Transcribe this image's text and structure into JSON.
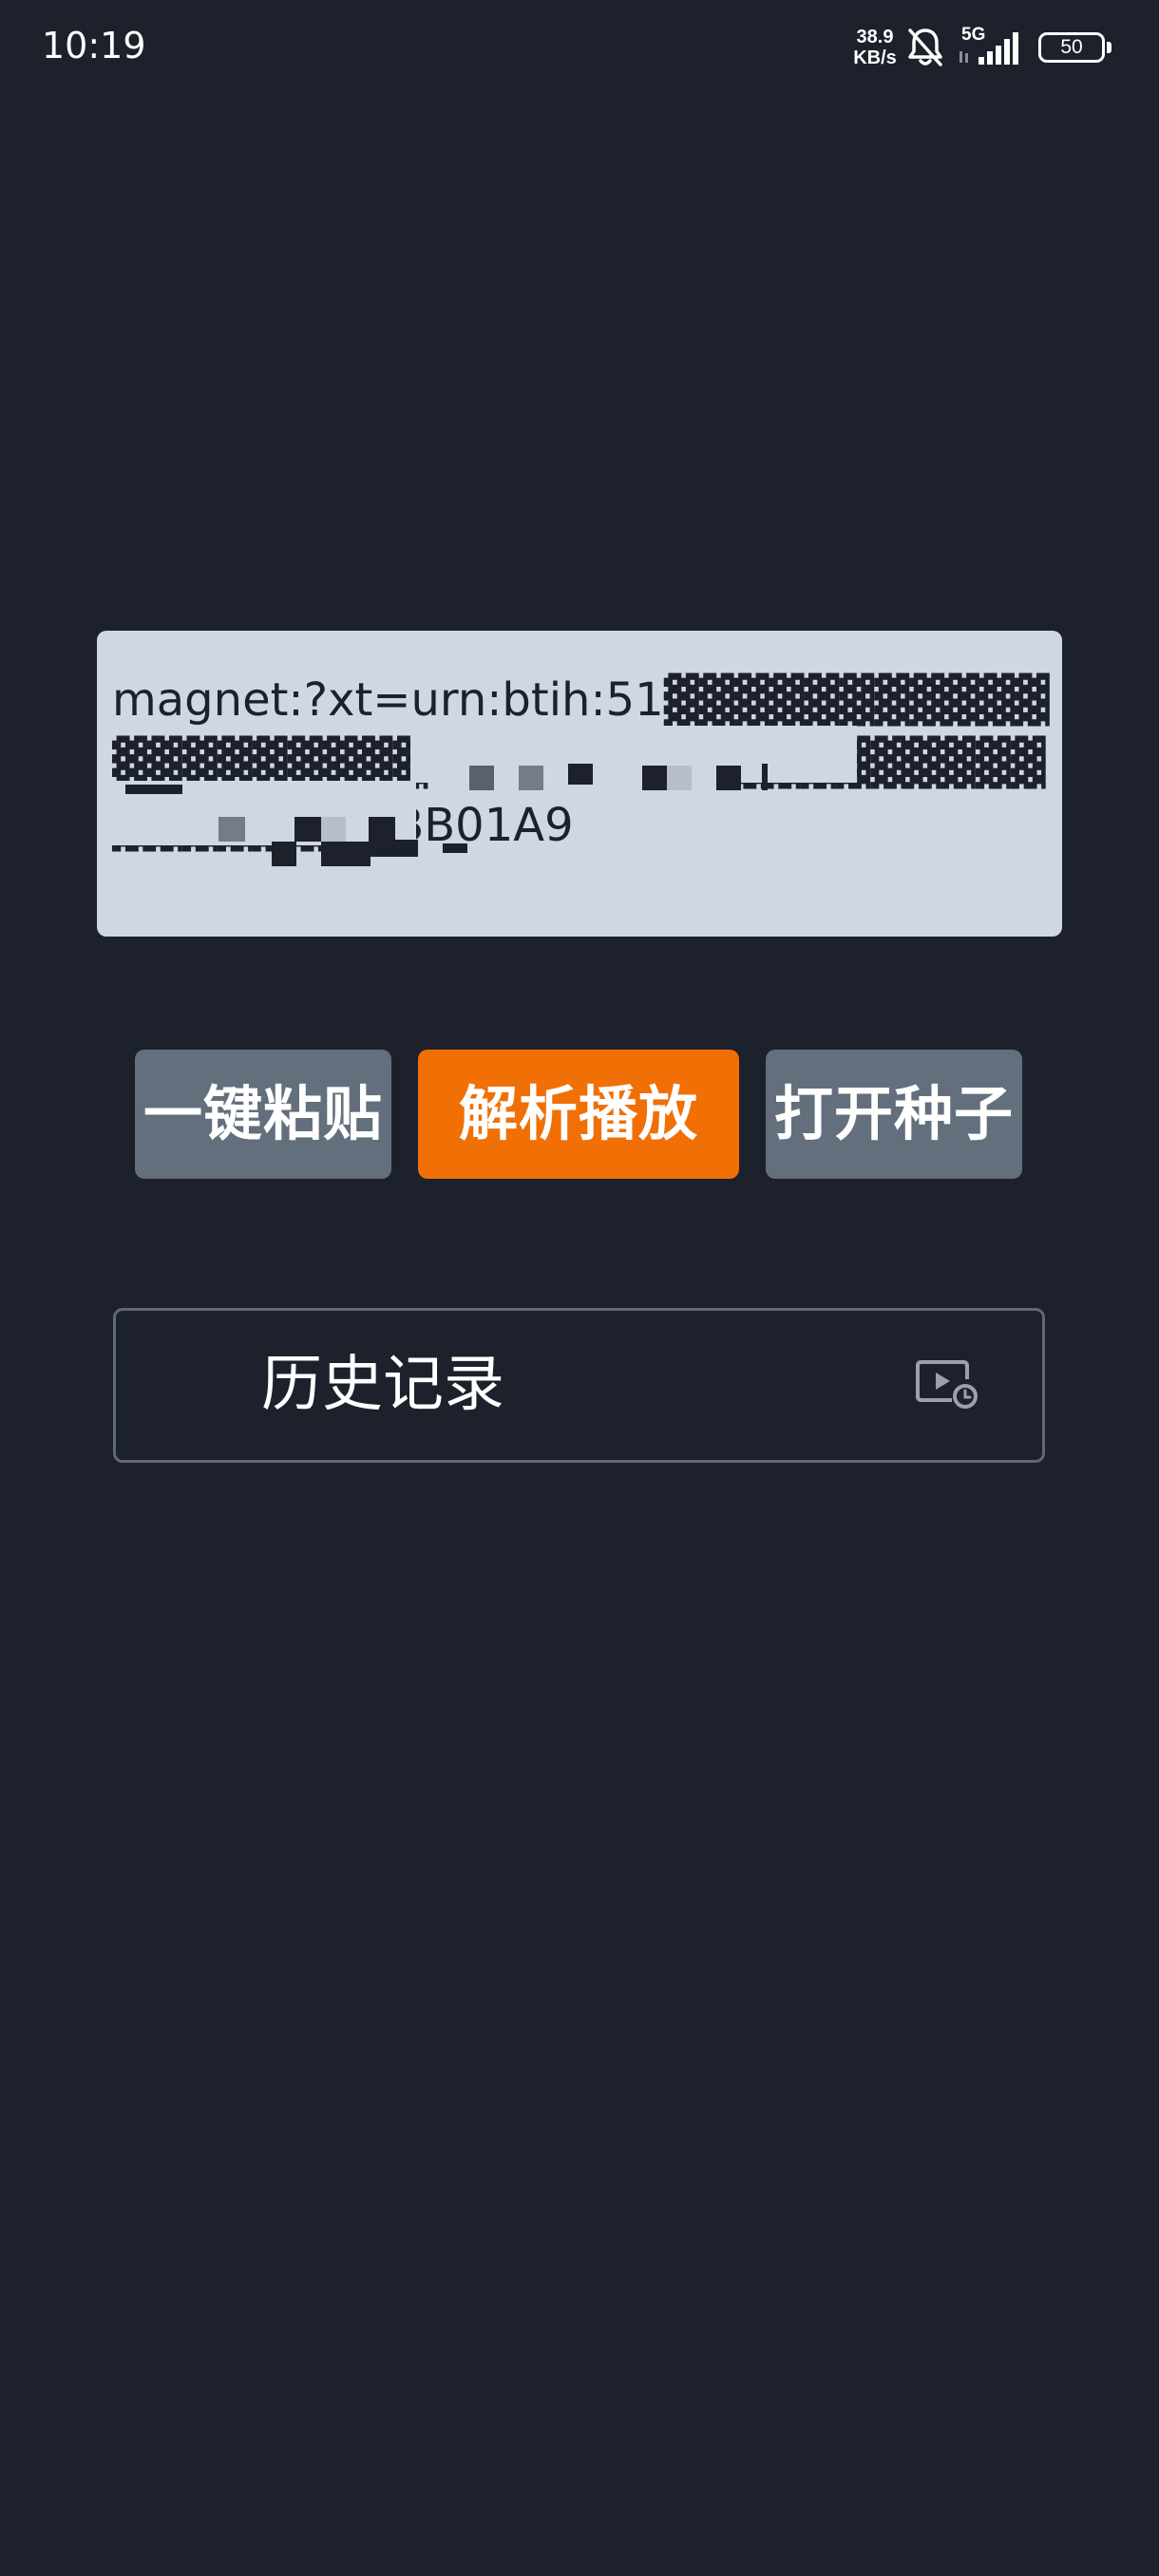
{
  "status_bar": {
    "time": "10:19",
    "speed_value": "38.9",
    "speed_unit": "KB/s",
    "network": "5G",
    "battery": "50",
    "icons": [
      "mute-icon",
      "signal-icon",
      "battery-icon"
    ]
  },
  "magnet_input": {
    "value": "magnet:?xt=urn:btih:51▓▓▓▓▓▓▓▓▓▓▓▓▓▓▓▓▓▓▓▓AC8BEE73D2▓▓▓▓▓▓▓▓▓▓▓▓▓▓▓▓▓BB01A9"
  },
  "buttons": {
    "paste": "一键粘贴",
    "parse_play": "解析播放",
    "open_torrent": "打开种子"
  },
  "history": {
    "label": "历史记录",
    "icon": "history-video-icon"
  },
  "colors": {
    "background": "#1c212b",
    "input_bg": "#cfd7e2",
    "primary": "#f07006",
    "secondary": "#636f7d",
    "border": "#5f6875"
  }
}
